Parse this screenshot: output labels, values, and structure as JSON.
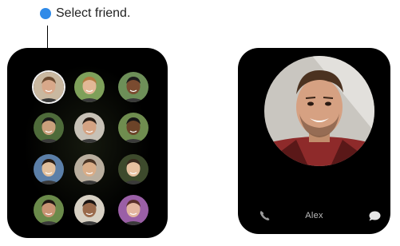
{
  "callout": {
    "text": "Select friend.",
    "dot_color": "#2f8ae8"
  },
  "friends_screen": {
    "friends": [
      {
        "skin": "#d8a88a",
        "bg": "#c9b8a0",
        "hair": "#6a4a30"
      },
      {
        "skin": "#e2b896",
        "bg": "#7ea05a",
        "hair": "#b0793e"
      },
      {
        "skin": "#7a4b30",
        "bg": "#6d8f58",
        "hair": "#1b1b1b"
      },
      {
        "skin": "#caa07c",
        "bg": "#4e6b3a",
        "hair": "#1a1a1a"
      },
      {
        "skin": "#d4a383",
        "bg": "#c7c1b6",
        "hair": "#2a1e16"
      },
      {
        "skin": "#6b4328",
        "bg": "#6f8d4f",
        "hair": "#161616"
      },
      {
        "skin": "#e1bf9c",
        "bg": "#5b7fa8",
        "hair": "#2a1d14"
      },
      {
        "skin": "#d9ad88",
        "bg": "#b9ae9e",
        "hair": "#4a3424"
      },
      {
        "skin": "#e7c1a0",
        "bg": "#3d4a2c",
        "hair": "#3a2a1e"
      },
      {
        "skin": "#c99474",
        "bg": "#6a8a4a",
        "hair": "#1f1712"
      },
      {
        "skin": "#9a6a4c",
        "bg": "#d7d0c3",
        "hair": "#181210"
      },
      {
        "skin": "#e3b6a0",
        "bg": "#9a5fa6",
        "hair": "#5a2e2a"
      }
    ]
  },
  "contact_screen": {
    "name": "Alex",
    "actions": [
      "phone-icon",
      "message-icon"
    ]
  }
}
